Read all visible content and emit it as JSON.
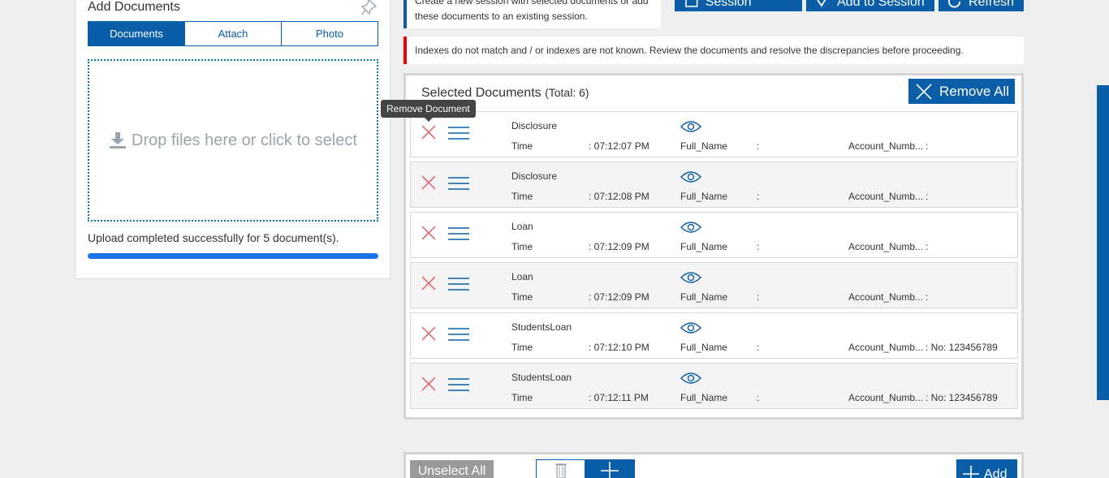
{
  "add_documents": {
    "title": "Add Documents",
    "tabs": [
      {
        "label": "Documents",
        "active": true
      },
      {
        "label": "Attach",
        "active": false
      },
      {
        "label": "Photo",
        "active": false
      }
    ],
    "dropzone_text": "Drop files here or click to select",
    "upload_message": "Upload completed successfully for 5 document(s).",
    "upload_progress": 1.0
  },
  "top_info": {
    "line1": "Create a new session with selected documents or add",
    "line2": "these documents to an existing session."
  },
  "top_buttons": {
    "create_session": "Create Session",
    "add_to_session": "Add to Session",
    "refresh": "Refresh"
  },
  "warning": "Indexes do not match and / or indexes are not known. Review the documents and resolve the discrepancies before proceeding.",
  "selected": {
    "title": "Selected Documents",
    "total": "(Total: 6)",
    "remove_all": "Remove All",
    "tooltip": "Remove Document",
    "documents": [
      {
        "name": "Disclosure",
        "time_label": "Time",
        "time": ": 07:12:07 PM",
        "full_name_label": "Full_Name",
        "full_name": ":",
        "account_label": "Account_Numb...",
        "account": ":"
      },
      {
        "name": "Disclosure",
        "time_label": "Time",
        "time": ": 07:12:08 PM",
        "full_name_label": "Full_Name",
        "full_name": ":",
        "account_label": "Account_Numb...",
        "account": ":"
      },
      {
        "name": "Loan",
        "time_label": "Time",
        "time": ": 07:12:09 PM",
        "full_name_label": "Full_Name",
        "full_name": ":",
        "account_label": "Account_Numb...",
        "account": ":"
      },
      {
        "name": "Loan",
        "time_label": "Time",
        "time": ": 07:12:09 PM",
        "full_name_label": "Full_Name",
        "full_name": ":",
        "account_label": "Account_Numb...",
        "account": ":"
      },
      {
        "name": "StudentsLoan",
        "time_label": "Time",
        "time": ": 07:12:10 PM",
        "full_name_label": "Full_Name",
        "full_name": ":",
        "account_label": "Account_Numb...",
        "account": ": No: 123456789"
      },
      {
        "name": "StudentsLoan",
        "time_label": "Time",
        "time": ": 07:12:11 PM",
        "full_name_label": "Full_Name",
        "full_name": ":",
        "account_label": "Account_Numb...",
        "account": ": No: 123456789"
      }
    ]
  },
  "bottom": {
    "unselect_all": "Unselect All",
    "add": "Add"
  },
  "colors": {
    "primary": "#0a5ea8",
    "danger": "#e00000",
    "remove_x": "#e06060",
    "progress": "#1a73e8"
  },
  "icons": {
    "pin": "pin-icon",
    "download": "download-icon",
    "remove": "close-icon",
    "reorder": "menu-icon",
    "preview": "eye-icon",
    "trash": "trash-icon",
    "plus": "plus-icon",
    "refresh": "refresh-icon",
    "check": "check-icon"
  }
}
